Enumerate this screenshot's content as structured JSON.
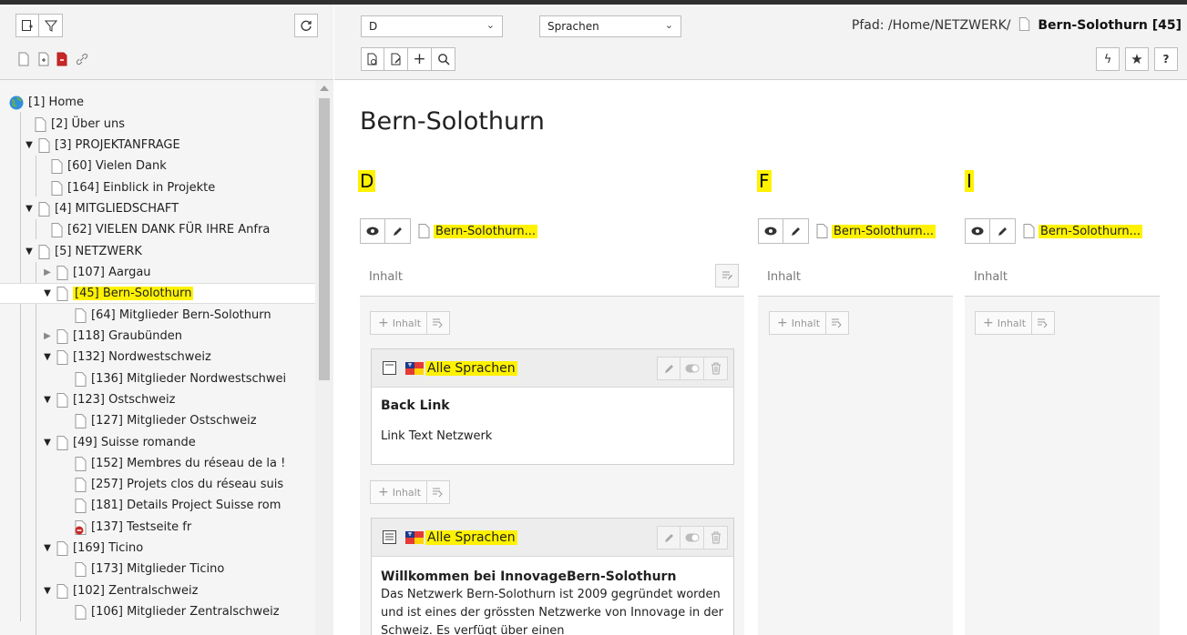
{
  "tree": {
    "nodes": [
      {
        "label": "[1] Home"
      },
      {
        "label": "[2] Über uns"
      },
      {
        "label": "[3] PROJEKTANFRAGE"
      },
      {
        "label": "[60] Vielen Dank"
      },
      {
        "label": "[164] Einblick in Projekte"
      },
      {
        "label": "[4] MITGLIEDSCHAFT"
      },
      {
        "label": "[62] VIELEN DANK FÜR IHRE Anfra"
      },
      {
        "label": "[5] NETZWERK"
      },
      {
        "label": "[107] Aargau"
      },
      {
        "label": "[45] Bern-Solothurn"
      },
      {
        "label": "[64] Mitglieder Bern-Solothurn"
      },
      {
        "label": "[118] Graubünden"
      },
      {
        "label": "[132] Nordwestschweiz"
      },
      {
        "label": "[136] Mitglieder Nordwestschwei"
      },
      {
        "label": "[123] Ostschweiz"
      },
      {
        "label": "[127] Mitglieder Ostschweiz"
      },
      {
        "label": "[49] Suisse romande"
      },
      {
        "label": "[152] Membres du réseau de la !"
      },
      {
        "label": "[257] Projets clos du réseau suis"
      },
      {
        "label": "[181] Details Project Suisse rom"
      },
      {
        "label": "[137] Testseite fr"
      },
      {
        "label": "[169] Ticino"
      },
      {
        "label": "[173] Mitglieder Ticino"
      },
      {
        "label": "[102] Zentralschweiz"
      },
      {
        "label": "[106] Mitglieder Zentralschweiz"
      }
    ]
  },
  "toolbar": {
    "language_select": "D",
    "view_select": "Sprachen",
    "path_prefix": "Pfad: /Home/NETZWERK/",
    "path_page": "Bern-Solothurn [45]"
  },
  "page": {
    "title": "Bern-Solothurn"
  },
  "columns": [
    {
      "lang": "D",
      "page_link": "Bern-Solothurn...",
      "header": "Inhalt",
      "add_label": "Inhalt"
    },
    {
      "lang": "F",
      "page_link": "Bern-Solothurn...",
      "header": "Inhalt",
      "add_label": "Inhalt"
    },
    {
      "lang": "I",
      "page_link": "Bern-Solothurn...",
      "header": "Inhalt",
      "add_label": "Inhalt"
    }
  ],
  "elements": [
    {
      "lang_label": "Alle Sprachen",
      "heading": "Back Link",
      "text": "Link Text  Netzwerk"
    },
    {
      "lang_label": "Alle Sprachen",
      "heading": "Willkommen bei InnovageBern-Solothurn",
      "text": "Das Netzwerk Bern-Solothurn ist 2009 gegründet worden und ist eines der grössten Netzwerke von Innovage in der Schweiz. Es verfügt über einen"
    }
  ],
  "add_between_label": "Inhalt",
  "colors": {
    "highlight": "#fff200",
    "panel_bg": "#f5f5f5",
    "toolbar_bg": "#f3f3f3"
  }
}
